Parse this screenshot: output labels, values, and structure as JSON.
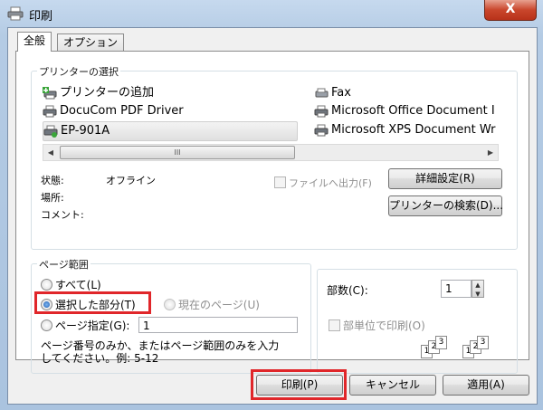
{
  "window": {
    "title": "印刷",
    "close_label": "X"
  },
  "tabs": [
    {
      "label": "全般"
    },
    {
      "label": "オプション"
    }
  ],
  "printer_section": {
    "legend": "プリンターの選択",
    "printers": [
      {
        "name": "プリンターの追加",
        "icon": "add-printer-icon"
      },
      {
        "name": "Fax",
        "icon": "fax-icon"
      },
      {
        "name": "DocuCom PDF Driver",
        "icon": "printer-icon"
      },
      {
        "name": "Microsoft Office Document I",
        "icon": "printer-icon"
      },
      {
        "name": "EP-901A",
        "icon": "printer-default-icon",
        "selected": true
      },
      {
        "name": "Microsoft XPS Document Wr",
        "icon": "printer-icon"
      }
    ],
    "scroll_left": "◀",
    "scroll_right": "▶",
    "scroll_thumb": "III",
    "status_label": "状態:",
    "status_value": "オフライン",
    "location_label": "場所:",
    "comment_label": "コメント:",
    "print_to_file_label": "ファイルへ出力(F)",
    "preferences_button": "詳細設定(R)",
    "find_printer_button": "プリンターの検索(D)..."
  },
  "page_range": {
    "legend": "ページ範囲",
    "all_label": "すべて(L)",
    "selection_label": "選択した部分(T)",
    "current_page_label": "現在のページ(U)",
    "pages_label": "ページ指定(G):",
    "pages_value": "1",
    "hint_line1": "ページ番号のみか、またはページ範囲のみを入力",
    "hint_line2": "してください。例: 5-12"
  },
  "copies": {
    "label": "部数(C):",
    "value": "1",
    "collate_label": "部単位で印刷(O)"
  },
  "buttons": {
    "print": "印刷(P)",
    "cancel": "キャンセル",
    "apply": "適用(A)"
  },
  "colors": {
    "highlight": "#e0262a",
    "close_button": "#c9462c"
  }
}
